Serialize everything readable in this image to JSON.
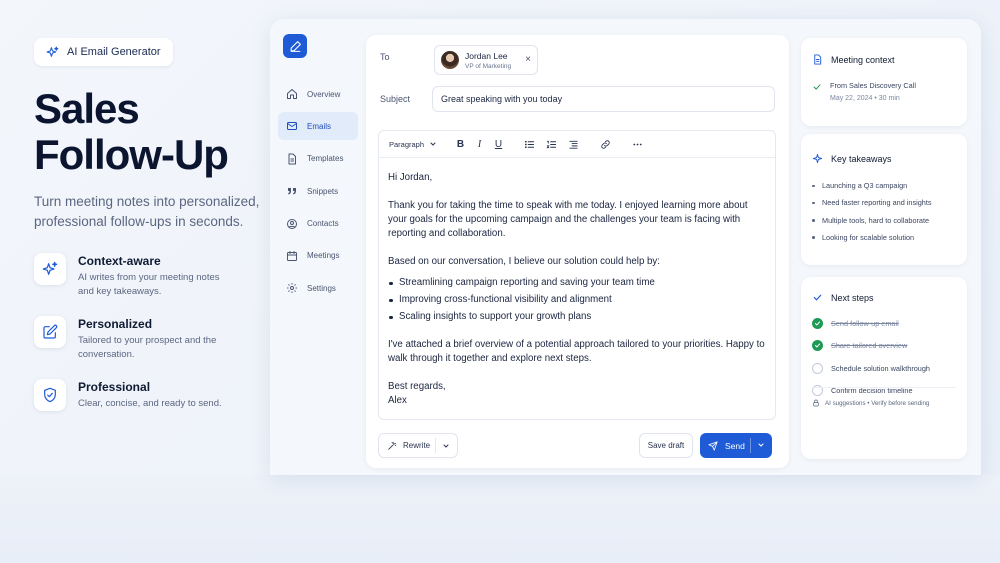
{
  "hero": {
    "badge": "AI Email Generator",
    "title_line1": "Sales",
    "title_line2": "Follow-Up",
    "subtitle": "Turn meeting notes into personalized, professional follow-ups in seconds.",
    "features": [
      {
        "title": "Context-aware",
        "desc": "AI writes from your meeting notes and key takeaways.",
        "icon": "sparkle-icon"
      },
      {
        "title": "Personalized",
        "desc": "Tailored to your prospect and the conversation.",
        "icon": "edit-icon"
      },
      {
        "title": "Professional",
        "desc": "Clear, concise, and ready to send.",
        "icon": "shield-check-icon"
      }
    ]
  },
  "sidebar": {
    "items": [
      {
        "label": "Overview",
        "icon": "home-icon",
        "active": false
      },
      {
        "label": "Emails",
        "icon": "mail-icon",
        "active": true
      },
      {
        "label": "Templates",
        "icon": "document-icon",
        "active": false
      },
      {
        "label": "Snippets",
        "icon": "quote-icon",
        "active": false
      },
      {
        "label": "Contacts",
        "icon": "user-circle-icon",
        "active": false
      },
      {
        "label": "Meetings",
        "icon": "calendar-icon",
        "active": false
      },
      {
        "label": "Settings",
        "icon": "gear-icon",
        "active": false
      }
    ]
  },
  "compose": {
    "to_label": "To",
    "recipient_name": "Jordan Lee",
    "recipient_role": "VP of Marketing",
    "remove_glyph": "×",
    "subject_label": "Subject",
    "subject_value": "Great speaking with you today",
    "toolbar": {
      "paragraph": "Paragraph",
      "bold": "B",
      "italic": "I",
      "underline": "U"
    },
    "body": {
      "greeting": "Hi Jordan,",
      "para1": "Thank you for taking the time to speak with me today. I enjoyed learning more about your goals for the upcoming campaign and the challenges your team is facing with reporting and collaboration.",
      "para2": "Based on our conversation, I believe our solution could help by:",
      "bullets": [
        "Streamlining campaign reporting and saving your team time",
        "Improving cross-functional visibility and alignment",
        "Scaling insights to support your growth plans"
      ],
      "para3": "I've attached a brief overview of a potential approach tailored to your priorities. Happy to walk through it together and explore next steps.",
      "signoff": "Best regards,",
      "signature": "Alex"
    },
    "rewrite_label": "Rewrite",
    "save_draft_label": "Save draft",
    "send_label": "Send"
  },
  "meeting_context": {
    "title": "Meeting context",
    "source": "From Sales Discovery Call",
    "meta": "May 22, 2024  •  30 min"
  },
  "key_takeaways": {
    "title": "Key takeaways",
    "items": [
      "Launching a Q3 campaign",
      "Need faster reporting and insights",
      "Multiple tools, hard to collaborate",
      "Looking for scalable solution"
    ]
  },
  "next_steps": {
    "title": "Next steps",
    "items": [
      {
        "label": "Send follow-up email",
        "done": true
      },
      {
        "label": "Share tailored overview",
        "done": true
      },
      {
        "label": "Schedule solution walkthrough",
        "done": false
      },
      {
        "label": "Confirm decision timeline",
        "done": false
      }
    ],
    "footer": "AI suggestions  •  Verify before sending"
  },
  "colors": {
    "accent": "#1f5bd6",
    "success": "#1f9a55",
    "heading": "#0b1530"
  }
}
